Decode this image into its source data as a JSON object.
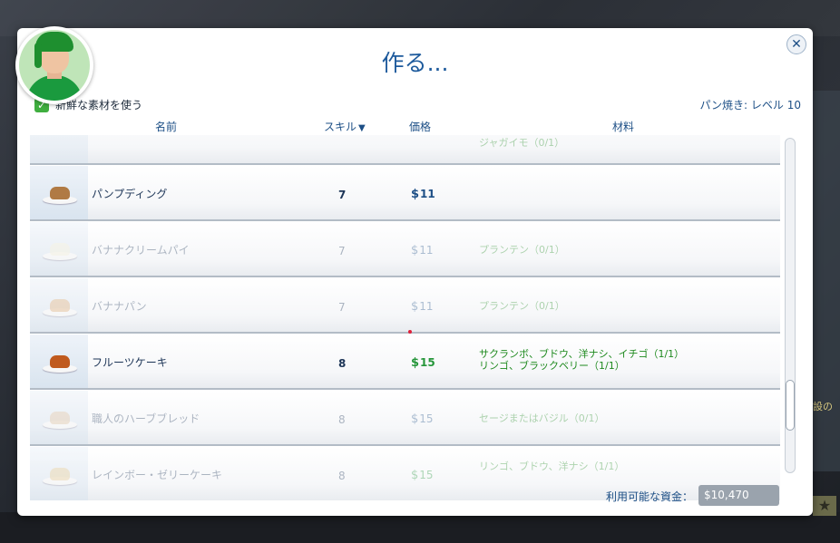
{
  "dialog": {
    "title": "作る...",
    "close_icon": "close-icon",
    "fresh_ingredients_label": "新鮮な素材を使う",
    "fresh_ingredients_checked": true,
    "skill_info": "パン焼き: レベル 10"
  },
  "columns": {
    "name": "名前",
    "skill": "スキル",
    "price": "価格",
    "materials": "材料"
  },
  "rows": [
    {
      "name": "",
      "skill": "",
      "price": "",
      "materials": "ジャガイモ（0/1）",
      "available": false,
      "food_color": "#e8e0d0"
    },
    {
      "name": "パンプディング",
      "skill": "7",
      "price": "11",
      "materials": "",
      "available": true,
      "food_color": "#b07a44"
    },
    {
      "name": "バナナクリームパイ",
      "skill": "7",
      "price": "11",
      "materials": "プランテン（0/1）",
      "available": false,
      "food_color": "#f4efd0"
    },
    {
      "name": "バナナパン",
      "skill": "7",
      "price": "11",
      "materials": "プランテン（0/1）",
      "available": false,
      "food_color": "#d99a5a"
    },
    {
      "name": "フルーツケーキ",
      "skill": "8",
      "price": "15",
      "materials": "サクランボ、ブドウ、洋ナシ、イチゴ（1/1）\nリンゴ、ブラックベリー（1/1）",
      "available": true,
      "food_color": "#c05a1e"
    },
    {
      "name": "職人のハーブブレッド",
      "skill": "8",
      "price": "15",
      "materials": "セージまたはバジル（0/1）",
      "available": false,
      "food_color": "#d8b48a"
    },
    {
      "name": "レインボー・ゼリーケーキ",
      "skill": "8",
      "price": "15",
      "materials": "リンゴ、ブドウ、洋ナシ（1/1）",
      "available": false,
      "food_color": "#e2c07a"
    }
  ],
  "currency_symbol": "$",
  "funds": {
    "label": "利用可能な資金：",
    "value": "$10,470"
  },
  "background": {
    "side_label": "設の",
    "star": "★"
  },
  "colors": {
    "accent": "#1d5a9c",
    "ok_green": "#1f8a1f"
  }
}
